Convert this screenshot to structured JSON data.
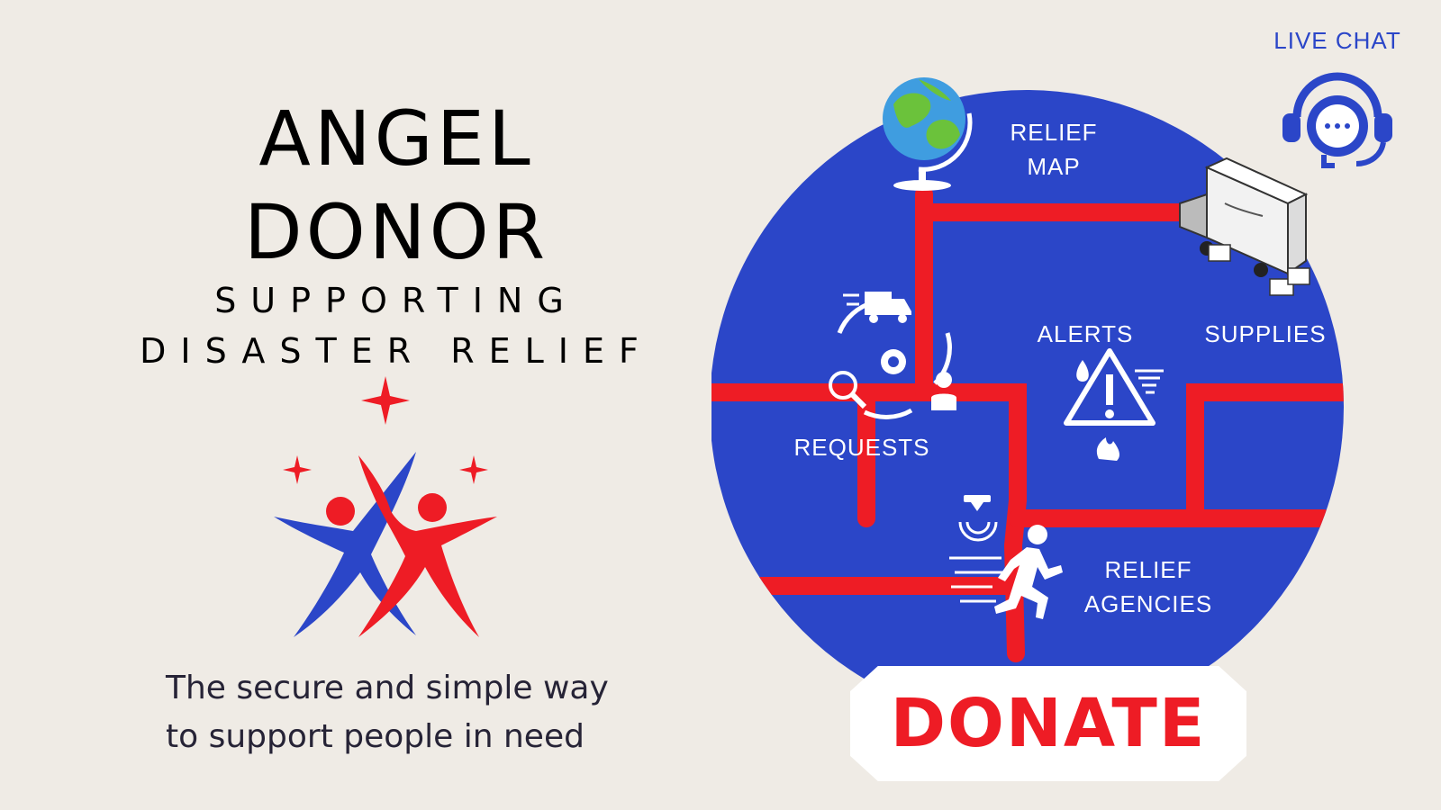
{
  "brand": {
    "title_line1": "ANGEL",
    "title_line2": "DONOR",
    "subtitle_line1": "SUPPORTING",
    "subtitle_line2": "DISASTER RELIEF",
    "tagline_line1": "The secure and simple way",
    "tagline_line2": "to support people in need"
  },
  "live_chat": {
    "label": "LIVE CHAT"
  },
  "panel": {
    "relief_map": {
      "line1": "RELIEF",
      "line2": "MAP"
    },
    "supplies": {
      "label": "SUPPLIES"
    },
    "alerts": {
      "label": "ALERTS"
    },
    "requests": {
      "label": "REQUESTS"
    },
    "relief_agencies": {
      "line1": "RELIEF",
      "line2": "AGENCIES"
    }
  },
  "donate": {
    "label": "DONATE"
  },
  "colors": {
    "background": "#efebe5",
    "panel_blue": "#2b46c8",
    "accent_red": "#ee1c25",
    "white": "#ffffff"
  },
  "icons": [
    "globe-icon",
    "delivery-truck-icon",
    "requests-cycle-icon",
    "warning-triangle-icon",
    "running-person-icon",
    "live-chat-headset-icon",
    "sparkle-icon",
    "people-logo-icon"
  ]
}
